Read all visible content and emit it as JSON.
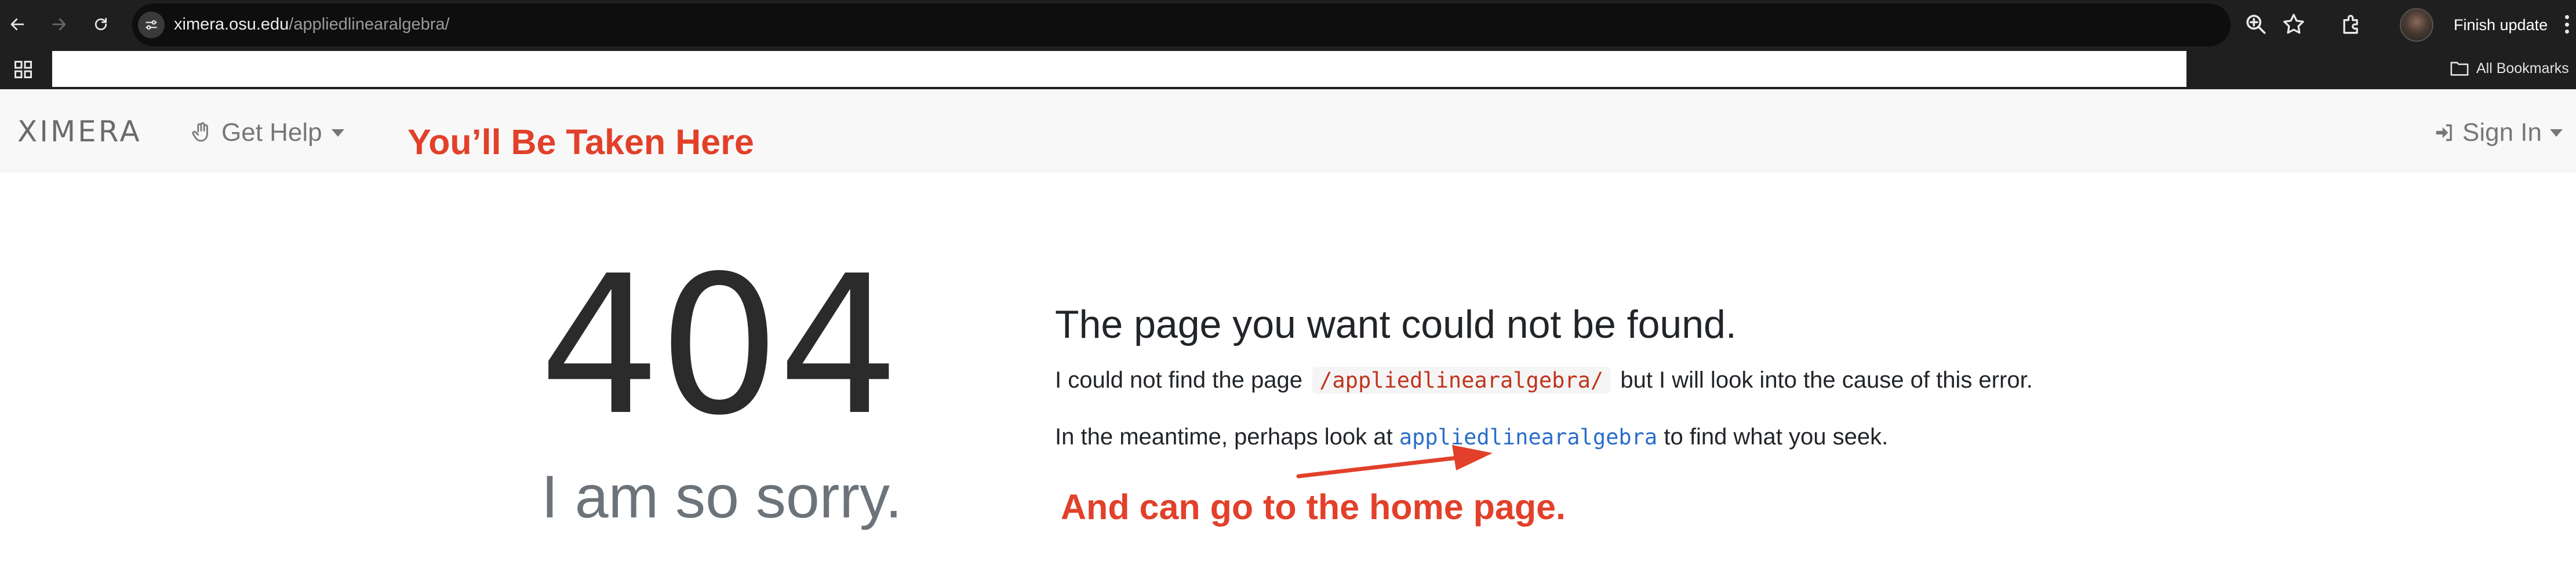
{
  "browser": {
    "url_host": "ximera.osu.edu",
    "url_path": "/appliedlinearalgebra/",
    "finish_update_label": "Finish update",
    "all_bookmarks_label": "All Bookmarks"
  },
  "site_nav": {
    "logo_text": "XIMERA",
    "get_help_label": "Get Help",
    "sign_in_label": "Sign In"
  },
  "annotations": {
    "top": "You’ll Be Taken Here",
    "bottom": "And can go to the home page.",
    "color": "#e2402a"
  },
  "error_page": {
    "code": "404",
    "apology": "I am so sorry.",
    "headline": "The page you want could not be found.",
    "para1_before": "I could not find the page",
    "para1_path": "/appliedlinearalgebra/",
    "para1_after": "but I will look into the cause of this error.",
    "para2_before": "In the meantime, perhaps look at",
    "para2_link": "appliedlinearalgebra",
    "para2_after": "to find what you seek."
  },
  "colors": {
    "chrome_bg": "#1f1f1f",
    "nav_bg": "#f8f8f8",
    "link": "#2a6dc9",
    "code": "#c0341d",
    "text": "#212529",
    "muted": "#6c737a"
  },
  "icons": [
    "back-icon",
    "forward-icon",
    "reload-icon",
    "site-info-icon",
    "zoom-icon",
    "bookmark-star-icon",
    "extensions-icon",
    "apps-grid-icon",
    "folder-icon",
    "hand-icon",
    "sign-in-icon",
    "kebab-menu-icon"
  ]
}
